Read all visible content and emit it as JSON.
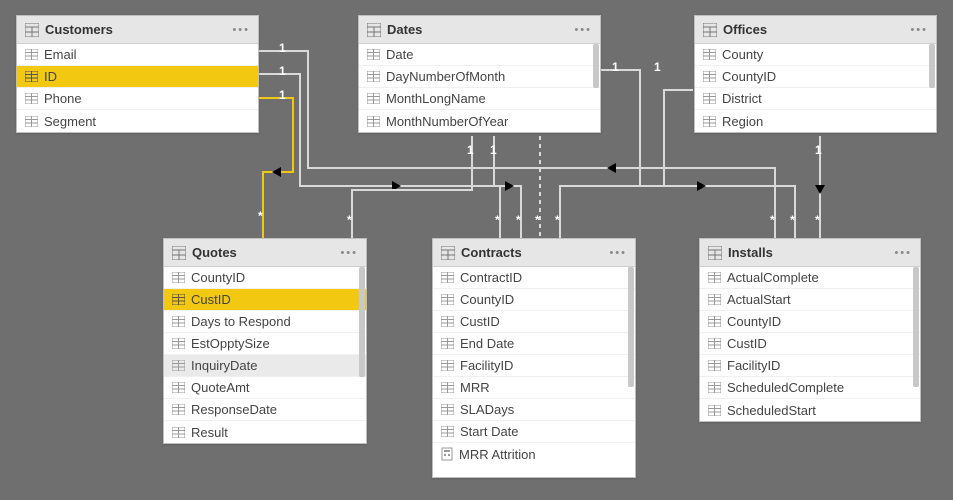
{
  "tables": {
    "customers": {
      "title": "Customers",
      "fields": [
        "Email",
        "ID",
        "Phone",
        "Segment"
      ],
      "selectedIndex": 1
    },
    "dates": {
      "title": "Dates",
      "fields": [
        "Date",
        "DayNumberOfMonth",
        "MonthLongName",
        "MonthNumberOfYear"
      ]
    },
    "offices": {
      "title": "Offices",
      "fields": [
        "County",
        "CountyID",
        "District",
        "Region"
      ]
    },
    "quotes": {
      "title": "Quotes",
      "fields": [
        "CountyID",
        "CustID",
        "Days to Respond",
        "EstOpptySize",
        "InquiryDate",
        "QuoteAmt",
        "ResponseDate",
        "Result"
      ],
      "selectedIndex": 1,
      "highlightIndex": 4
    },
    "contracts": {
      "title": "Contracts",
      "fields": [
        "ContractID",
        "CountyID",
        "CustID",
        "End Date",
        "FacilityID",
        "MRR",
        "SLADays",
        "Start Date",
        "MRR Attrition"
      ]
    },
    "installs": {
      "title": "Installs",
      "fields": [
        "ActualComplete",
        "ActualStart",
        "CountyID",
        "CustID",
        "FacilityID",
        "ScheduledComplete",
        "ScheduledStart"
      ]
    }
  },
  "relationships": [
    {
      "from": "customers",
      "to": "quotes",
      "fromCard": "1",
      "toCard": "*",
      "active": true,
      "highlighted": true
    },
    {
      "from": "customers",
      "to": "contracts",
      "fromCard": "1",
      "toCard": "*",
      "active": true
    },
    {
      "from": "customers",
      "to": "installs",
      "fromCard": "1",
      "toCard": "*",
      "active": true
    },
    {
      "from": "dates",
      "to": "quotes",
      "fromCard": "1",
      "toCard": "*",
      "active": true
    },
    {
      "from": "dates",
      "to": "contracts",
      "fromCard": "1",
      "toCard": "*",
      "active": true
    },
    {
      "from": "dates",
      "to": "contracts",
      "fromCard": "1",
      "toCard": "*",
      "active": false
    },
    {
      "from": "dates",
      "to": "installs",
      "fromCard": "1",
      "toCard": "*",
      "active": true
    },
    {
      "from": "offices",
      "to": "contracts",
      "fromCard": "1",
      "toCard": "*",
      "active": true
    },
    {
      "from": "offices",
      "to": "installs",
      "fromCard": "1",
      "toCard": "*",
      "active": true
    }
  ]
}
